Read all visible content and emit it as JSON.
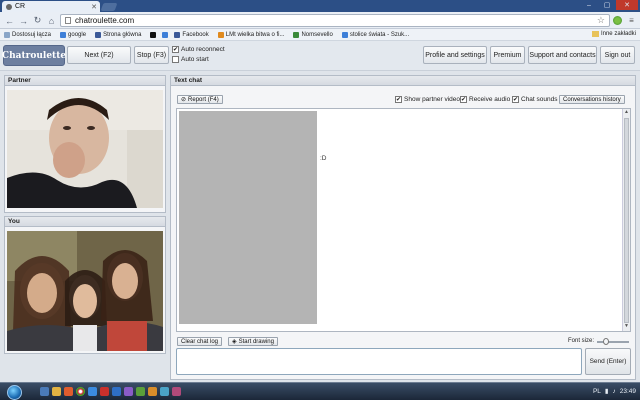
{
  "browser": {
    "tab_title": "CR",
    "url": "chatroulette.com",
    "bookmarks": [
      {
        "label": "Dostosuj łącza",
        "color": "#8aa6c8"
      },
      {
        "label": "google",
        "color": "#3d7fd8"
      },
      {
        "label": "Strona główna",
        "color": "#3b5998"
      },
      {
        "label": "",
        "color": "#111111"
      },
      {
        "label": "",
        "color": "#3d7fd8"
      },
      {
        "label": "Facebook",
        "color": "#3b5998"
      },
      {
        "label": "LMt wielka bitwa o fi...",
        "color": "#e08a1e"
      },
      {
        "label": "Nomsevello",
        "color": "#3a8a3a"
      },
      {
        "label": "stolice świata - Szuk...",
        "color": "#3d7fd8"
      }
    ],
    "other_bookmarks": "Inne zakładki"
  },
  "header": {
    "logo": "Chatroulette",
    "next_label": "Next (F2)",
    "stop_label": "Stop (F3)",
    "auto_reconnect": "Auto reconnect",
    "auto_start": "Auto start",
    "profile_label": "Profile and settings",
    "premium_label": "Premium",
    "support_label": "Support and contacts",
    "signout_label": "Sign out"
  },
  "partner_panel": {
    "title": "Partner"
  },
  "you_panel": {
    "title": "You"
  },
  "chat": {
    "title": "Text chat",
    "report_label": "Report (F4)",
    "show_partner_video": "Show partner video",
    "receive_audio": "Receive audio",
    "chat_sounds": "Chat sounds",
    "history_label": "Conversations history",
    "fragment": ":D",
    "clear_label": "Clear chat log",
    "draw_label": "Start drawing",
    "font_size_label": "Font size:",
    "send_label": "Send (Enter)"
  },
  "taskbar": {
    "lang": "PL",
    "time": "23:49"
  }
}
